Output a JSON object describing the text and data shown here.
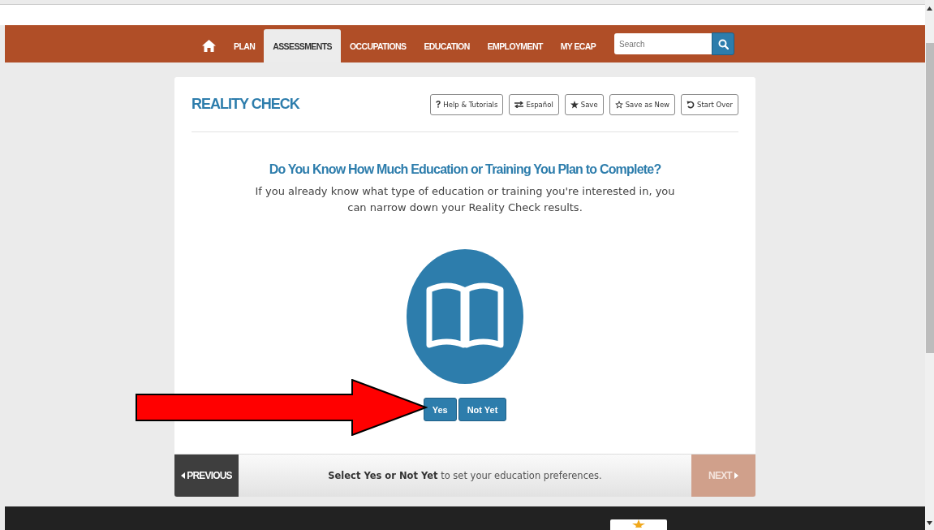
{
  "nav": {
    "items": [
      {
        "kind": "home",
        "selected": false
      },
      {
        "kind": "text",
        "label": "PLAN",
        "selected": false
      },
      {
        "kind": "text",
        "label": "ASSESSMENTS",
        "selected": true
      },
      {
        "kind": "text",
        "label": "OCCUPATIONS",
        "selected": false
      },
      {
        "kind": "text",
        "label": "EDUCATION",
        "selected": false
      },
      {
        "kind": "text",
        "label": "EMPLOYMENT",
        "selected": false
      },
      {
        "kind": "text",
        "label": "MY ECAP",
        "selected": false
      }
    ],
    "search": {
      "placeholder": "Search"
    }
  },
  "card": {
    "title": "REALITY CHECK",
    "tools": [
      {
        "label": "Help & Tutorials"
      },
      {
        "label": "Español"
      },
      {
        "label": "Save"
      },
      {
        "label": "Save as New"
      },
      {
        "label": "Start Over"
      }
    ],
    "question": "Do You Know How Much Education or Training You Plan to Complete?",
    "description": "If you already know what type of education or training you're interested in, you can narrow down your Reality Check results.",
    "answers": [
      "Yes",
      "Not Yet"
    ]
  },
  "footer_bar": {
    "previous": "PREVIOUS",
    "message": "**Select Yes or Not Yet** to set your education preferences.",
    "next": "NEXT",
    "next_disabled": true
  }
}
